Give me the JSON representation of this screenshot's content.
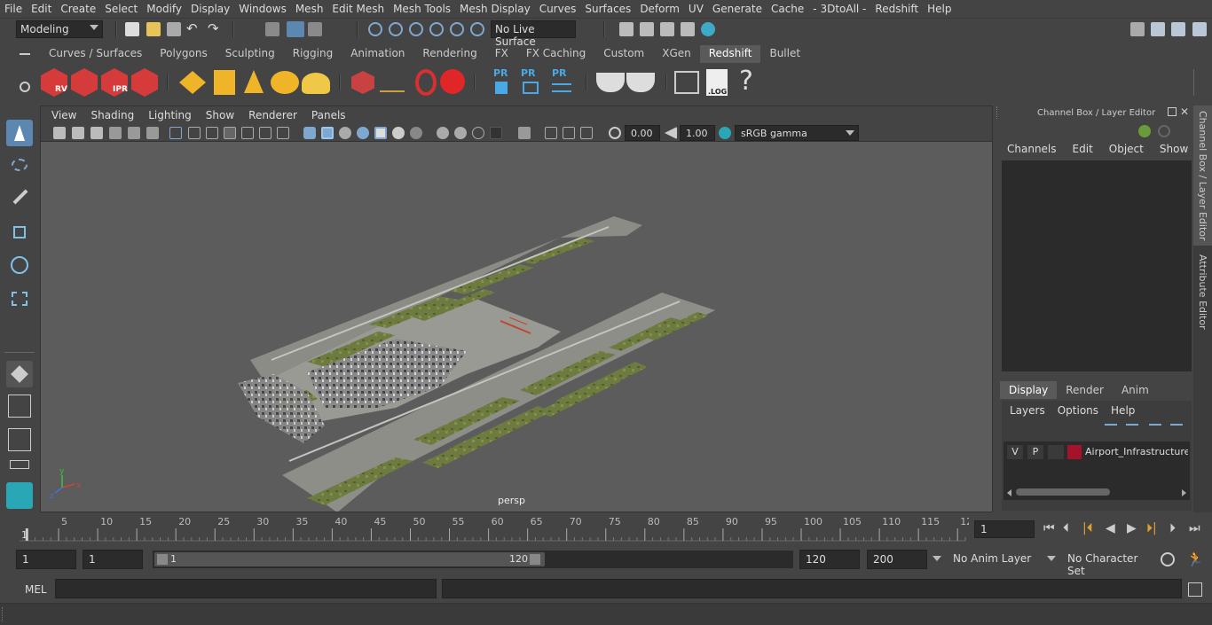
{
  "menubar": [
    "File",
    "Edit",
    "Create",
    "Select",
    "Modify",
    "Display",
    "Windows",
    "Mesh",
    "Edit Mesh",
    "Mesh Tools",
    "Mesh Display",
    "Curves",
    "Surfaces",
    "Deform",
    "UV",
    "Generate",
    "Cache",
    "- 3DtoAll -",
    "Redshift",
    "Help"
  ],
  "status": {
    "mode": "Modeling",
    "live_surface": "No Live Surface"
  },
  "shelf_tabs": [
    "Curves / Surfaces",
    "Polygons",
    "Sculpting",
    "Rigging",
    "Animation",
    "Rendering",
    "FX",
    "FX Caching",
    "Custom",
    "XGen",
    "Redshift",
    "Bullet"
  ],
  "shelf_active": "Redshift",
  "shelf_labels": {
    "rv": "RV",
    "ipr": "IPR",
    "pr": "PR",
    "log": ".LOG",
    "help": "?"
  },
  "viewport": {
    "menus": [
      "View",
      "Shading",
      "Lighting",
      "Show",
      "Renderer",
      "Panels"
    ],
    "exposure": "0.00",
    "gamma": "1.00",
    "color_space": "sRGB gamma",
    "camera": "persp",
    "axis": {
      "x": "x",
      "y": "y",
      "z": "z"
    }
  },
  "channel_box": {
    "title": "Channel Box / Layer Editor",
    "menus": [
      "Channels",
      "Edit",
      "Object",
      "Show"
    ]
  },
  "layer_editor": {
    "tabs": [
      "Display",
      "Render",
      "Anim"
    ],
    "active_tab": "Display",
    "menus": [
      "Layers",
      "Options",
      "Help"
    ],
    "layer": {
      "v": "V",
      "p": "P",
      "name": "Airport_Infrastructure_",
      "color": "#a3132c"
    }
  },
  "side_tabs": [
    "Channel Box / Layer Editor",
    "Attribute Editor"
  ],
  "timeline": {
    "ticks": [
      "5",
      "10",
      "15",
      "20",
      "25",
      "30",
      "35",
      "40",
      "45",
      "50",
      "55",
      "60",
      "65",
      "70",
      "75",
      "80",
      "85",
      "90",
      "95",
      "100",
      "105",
      "110",
      "115",
      "12"
    ],
    "start_mark": "1",
    "current_frame": "1"
  },
  "range": {
    "start": "1",
    "playback_start": "1",
    "slider_start": "1",
    "slider_end": "120",
    "playback_end": "120",
    "end": "200",
    "anim_layer": "No Anim Layer",
    "character_set": "No Character Set"
  },
  "cmd": {
    "label": "MEL"
  }
}
